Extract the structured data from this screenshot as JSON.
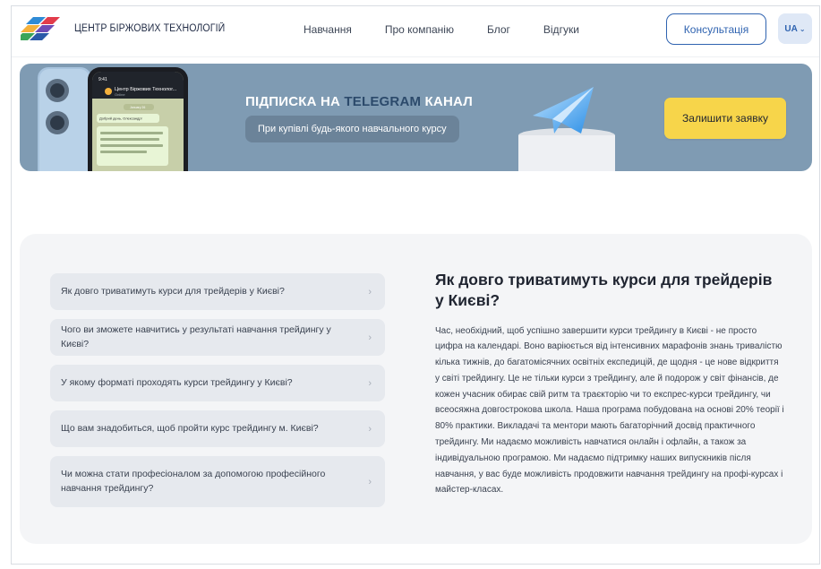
{
  "header": {
    "logo_text": "ЦЕНТР БІРЖОВИХ ТЕХНОЛОГІЙ",
    "nav": [
      "Навчання",
      "Про компанію",
      "Блог",
      "Відгуки"
    ],
    "consult_button": "Консультація",
    "language": "UA",
    "colors": {
      "accent": "#2f63b0",
      "lang_bg": "#dfe8f6"
    }
  },
  "banner": {
    "title_part1": "ПІДПИСКА НА ",
    "title_telegram": "TELEGRAM",
    "title_part2": " КАНАЛ",
    "subtitle": "При купівлі будь-якого навчального курсу",
    "request_button": "Залишити заявку",
    "phone": {
      "time": "9:41",
      "chat_name": "Центр Біржових Технолог...",
      "chat_status": "Online",
      "date": "January 26",
      "msg1": "Добрий день, Олександр!",
      "msg2": "Вітаємо! Ми у нашому телеграм каналі. Отримуйте новий інформації та інтерактиви прямо! Чи не ли є у вас питання?"
    },
    "colors": {
      "background": "#7f9bb3",
      "button": "#f7d54a"
    }
  },
  "faq": {
    "questions": [
      "Як довго триватимуть курси для трейдерів у Києві?",
      "Чого ви зможете навчитись у результаті навчання трейдингу у Києві?",
      "У якому форматі проходять курси трейдингу у Києві?",
      "Що вам знадобиться, щоб пройти курс трейдингу м. Києві?",
      "Чи можна стати професіоналом за допомогою професійного навчання трейдингу?"
    ],
    "answer_title": "Як довго триватимуть курси для трейдерів у Києві?",
    "answer_text": "Час, необхідний, щоб успішно завершити курси трейдингу в Києві - не просто цифра на календарі. Воно варіюється від інтенсивних марафонів знань тривалістю кілька тижнів, до багатомісячних освітніх експедицій, де щодня - це нове відкриття у світі трейдингу. Це не тільки курси з трейдингу, але й подорож у світ фінансів, де кожен учасник обирає свій ритм та траєкторію чи то експрес-курси трейдингу, чи всеосяжна довгострокова школа. Наша програма побудована на основі 20% теорії і 80% практики. Викладачі та ментори мають багаторічний досвід практичного трейдингу. Ми надаємо можливість навчатися онлайн і офлайн, а також за індивідуальною програмою. Ми надаємо підтримку наших випускників після навчання, у вас буде можливість продовжити навчання трейдингу на профі-курсах і майстер-класах.",
    "chevron_icon": "chevron-right-icon"
  }
}
